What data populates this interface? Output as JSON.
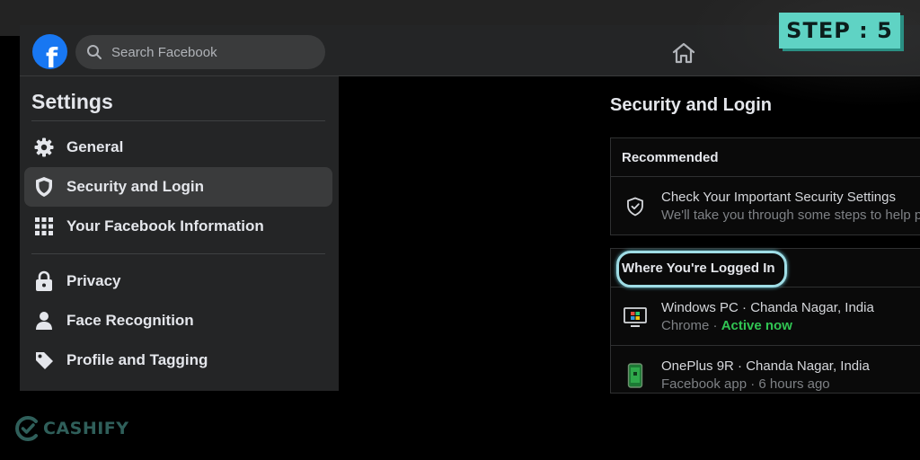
{
  "overlay": {
    "step_label": "STEP : 5",
    "brand": "CASHIFY"
  },
  "header": {
    "logo_letter": "f",
    "search_placeholder": "Search Facebook"
  },
  "sidebar": {
    "title": "Settings",
    "items": [
      {
        "label": "General",
        "icon": "gear-icon"
      },
      {
        "label": "Security and Login",
        "icon": "shield-icon",
        "active": true
      },
      {
        "label": "Your Facebook Information",
        "icon": "grid-icon"
      },
      {
        "label": "Privacy",
        "icon": "lock-icon"
      },
      {
        "label": "Face Recognition",
        "icon": "person-icon"
      },
      {
        "label": "Profile and Tagging",
        "icon": "tag-icon"
      }
    ]
  },
  "main": {
    "title": "Security and Login",
    "recommended": {
      "heading": "Recommended",
      "item_title": "Check Your Important Security Settings",
      "item_subtitle": "We'll take you through some steps to help p"
    },
    "logged_in": {
      "heading": "Where You're Logged In",
      "sessions": [
        {
          "device": "Windows PC",
          "location": "Chanda Nagar, India",
          "app": "Chrome",
          "status": "Active now"
        },
        {
          "device": "OnePlus 9R",
          "location": "Chanda Nagar, India",
          "app": "Facebook app",
          "status": "6 hours ago"
        }
      ]
    }
  },
  "colors": {
    "accent": "#1877f2",
    "active_status": "#31c553",
    "step_badge": "#5fd3c4",
    "highlight_ring": "#9fdde6"
  }
}
